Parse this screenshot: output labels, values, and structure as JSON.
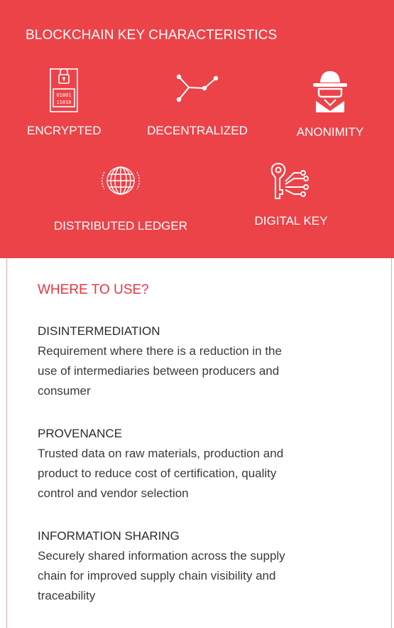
{
  "header": {
    "title": "BLOCKCHAIN KEY CHARACTERISTICS"
  },
  "features": [
    {
      "label": "ENCRYPTED",
      "icon": "encrypted-lock-icon"
    },
    {
      "label": "DECENTRALIZED",
      "icon": "decentralized-nodes-icon"
    },
    {
      "label": "ANONIMITY",
      "icon": "anonymous-spy-icon"
    },
    {
      "label": "DISTRIBUTED LEDGER",
      "icon": "globe-icon"
    },
    {
      "label": "DIGITAL KEY",
      "icon": "digital-key-icon"
    }
  ],
  "where": {
    "title": "WHERE TO USE?",
    "sections": [
      {
        "title": "DISINTERMEDIATION",
        "lines": [
          "Requirement where there is a reduction in the",
          "use of intermediaries between producers and",
          "consumer"
        ]
      },
      {
        "title": "PROVENANCE",
        "lines": [
          "Trusted data on raw materials, production and",
          "product to reduce cost of certification, quality",
          "control and vendor selection"
        ]
      },
      {
        "title": "INFORMATION SHARING",
        "lines": [
          "Securely shared information across the supply",
          "chain for improved supply chain visibility and",
          "traceability"
        ]
      }
    ]
  },
  "colors": {
    "accent": "#ec4349",
    "accent_text": "#e8363d",
    "body_text": "#3a3a3a"
  }
}
